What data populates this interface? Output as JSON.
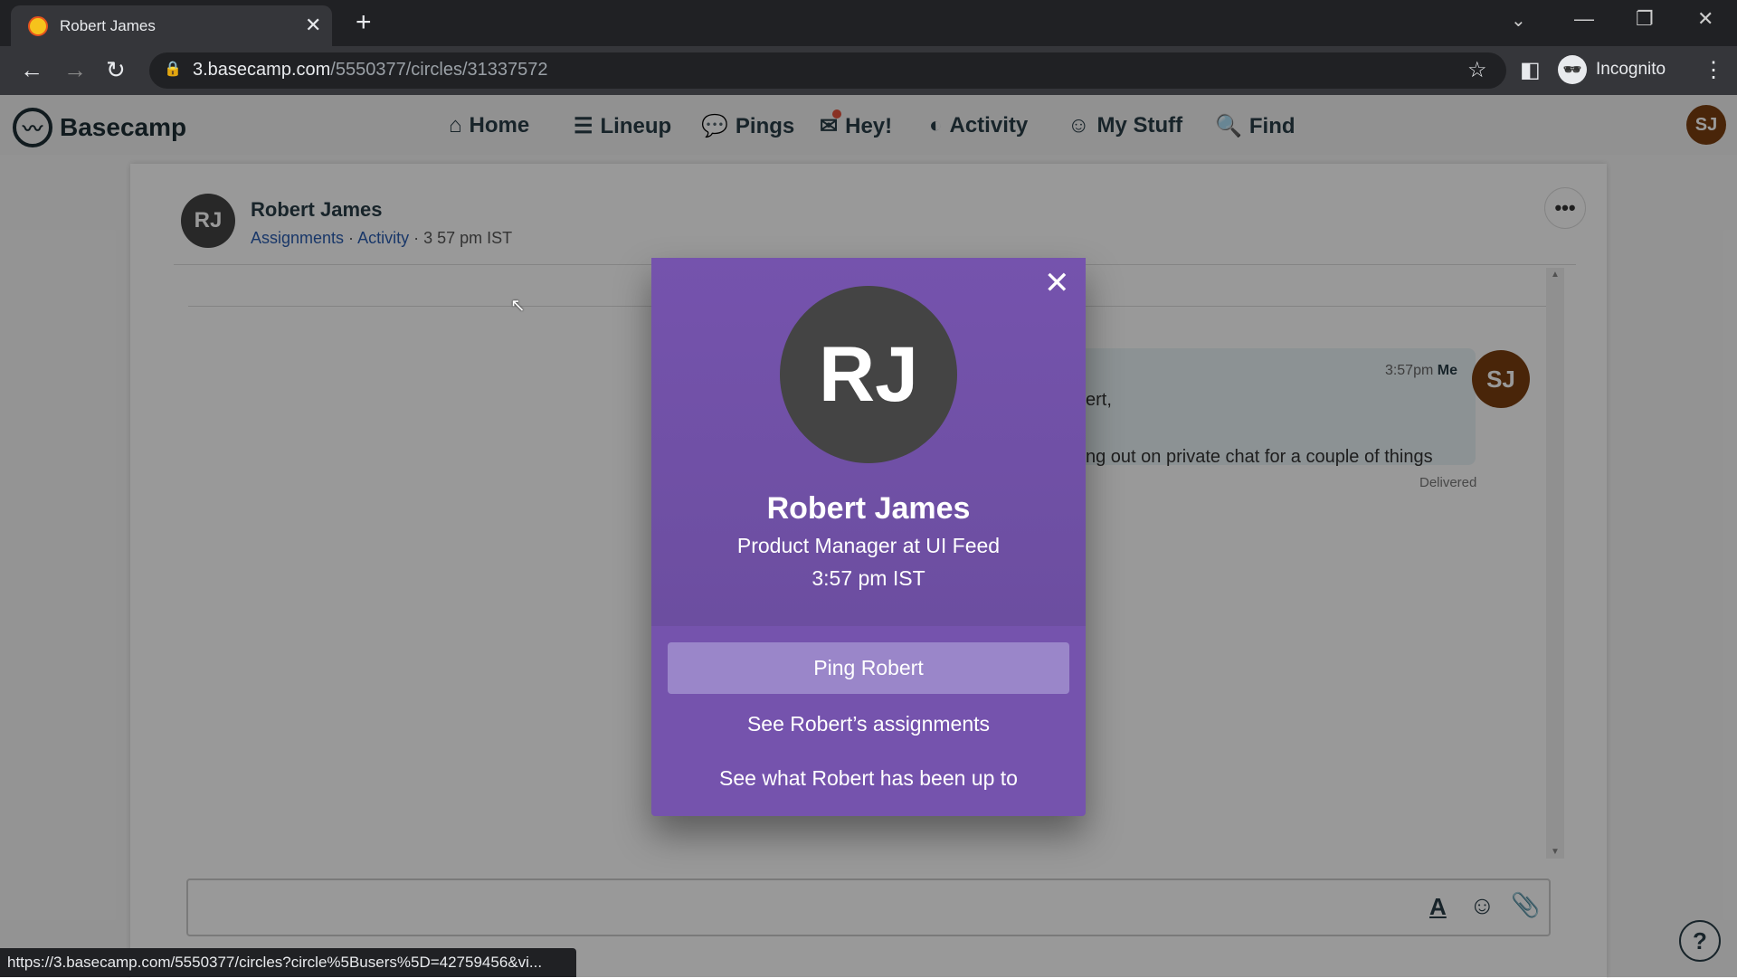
{
  "browser": {
    "tab_title": "Robert James",
    "url_host": "3.basecamp.com",
    "url_path": "/5550377/circles/31337572",
    "profile": "Incognito",
    "status_url": "https://3.basecamp.com/5550377/circles?circle%5Busers%5D=42759456&vi..."
  },
  "nav": {
    "brand": "Basecamp",
    "items": [
      {
        "label": "Home",
        "icon": "home-icon"
      },
      {
        "label": "Lineup",
        "icon": "lineup-icon"
      },
      {
        "label": "Pings",
        "icon": "pings-icon"
      },
      {
        "label": "Hey!",
        "icon": "bell-icon"
      },
      {
        "label": "Activity",
        "icon": "activity-icon"
      },
      {
        "label": "My Stuff",
        "icon": "smiley-icon"
      },
      {
        "label": "Find",
        "icon": "search-icon"
      }
    ],
    "user_initials": "SJ"
  },
  "chat": {
    "initials": "RJ",
    "name": "Robert James",
    "link_assignments": "Assignments",
    "link_activity": "Activity",
    "local_time": " · 3 57 pm IST",
    "sep": " · ",
    "message": {
      "time": "3:57pm",
      "author": "Me",
      "line1": "ert,",
      "line2": "ng out on private chat for a couple of things",
      "status": "Delivered",
      "initials": "SJ"
    }
  },
  "modal": {
    "initials": "RJ",
    "name": "Robert James",
    "title": "Product Manager at UI Feed",
    "time": "3:57 pm IST",
    "ping_button": "Ping Robert",
    "assignments_link": "See Robert’s assignments",
    "activity_link": "See what Robert has been up to"
  },
  "colors": {
    "modal": "#7553ad",
    "button": "#9a86c9",
    "sj_avatar": "#7b3f10",
    "rj_avatar": "#444444"
  }
}
